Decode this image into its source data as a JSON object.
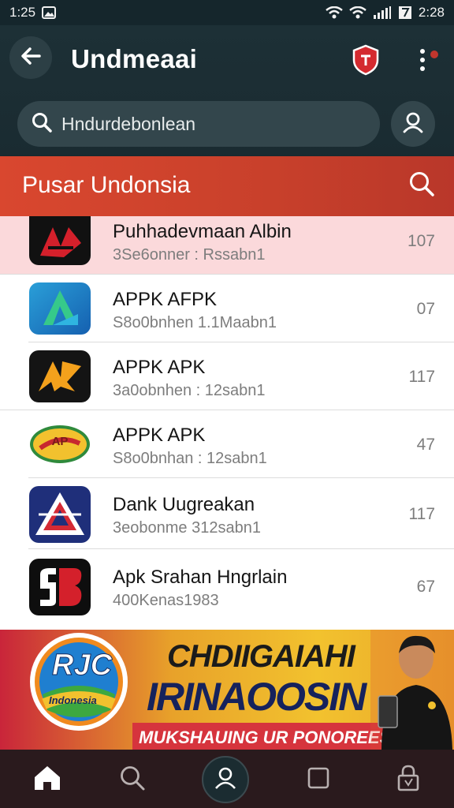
{
  "status_bar": {
    "time": "1:25",
    "right_text": "2:28"
  },
  "app_bar": {
    "title": "Undmeaai",
    "search_placeholder": "Hndurdebonlean"
  },
  "section": {
    "title": "Pusar Undonsia"
  },
  "apps": [
    {
      "title": "Puhhadevmaan Albin",
      "subtitle": "3Se6onner : Rssabn1",
      "count": "107",
      "icon": "ab-logo-icon",
      "highlighted": true
    },
    {
      "title": "APPK AFPK",
      "subtitle": "S8o0bnhen 1.1Maabn1",
      "count": "07",
      "icon": "a-triangle-logo-icon",
      "highlighted": false
    },
    {
      "title": "APPK APK",
      "subtitle": "3a0obnhen : 12sabn1",
      "count": "117",
      "icon": "ap-logo-icon",
      "highlighted": false
    },
    {
      "title": "APPK APK",
      "subtitle": "S8o0bnhan : 12sabn1",
      "count": "47",
      "icon": "ap-badge-logo-icon",
      "highlighted": false
    },
    {
      "title": "Dank Uugreakan",
      "subtitle": "3eobonme 312sabn1",
      "count": "117",
      "icon": "a-star-logo-icon",
      "highlighted": false
    },
    {
      "title": "Apk  Srahan Hngrlain",
      "subtitle": "400Kenas1983",
      "count": "67",
      "icon": "sb-logo-icon",
      "highlighted": false
    }
  ],
  "banner": {
    "logo_text": "RJC",
    "logo_subtext": "Indonesia",
    "headline1": "CHDIIGAIAHI",
    "headline2": "IRINAOOSIN",
    "subline": "MUKSHAUING UR PONOREES!"
  },
  "bottom_nav": [
    "home-icon",
    "search-icon",
    "profile-icon",
    "square-icon",
    "lock-icon"
  ],
  "colors": {
    "app_bar_bg": "#1b2d33",
    "section_bar": "#d0442e",
    "highlight_row": "#fbd9db",
    "nav_bg": "#2a1a1d"
  }
}
